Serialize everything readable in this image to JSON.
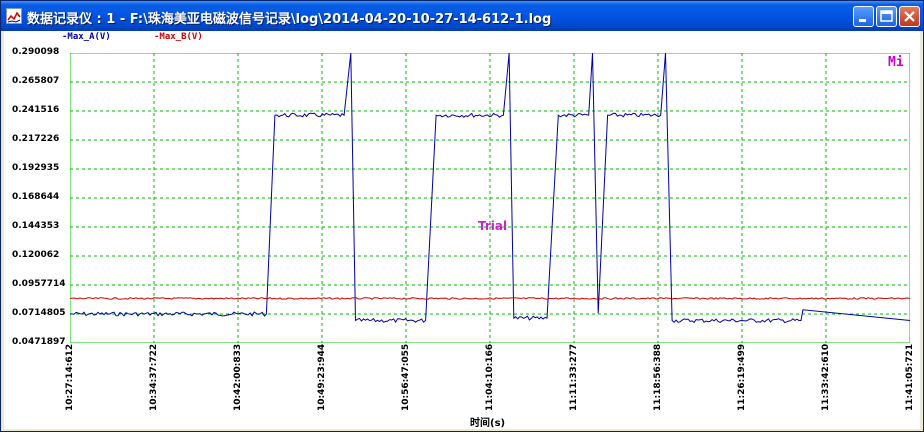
{
  "window": {
    "title": "数据记录仪 : 1 - F:\\珠海美亚电磁波信号记录\\log\\2014-04-20-10-27-14-612-1.log"
  },
  "legend": [
    {
      "label": "-Max_A(V)",
      "color": "#0000aa"
    },
    {
      "label": "-Max_B(V)",
      "color": "#cc0000"
    }
  ],
  "watermark": "Trial",
  "corner_mark": "Mi",
  "chart_data": {
    "type": "line",
    "xlabel": "时间(s)",
    "ylabel": "",
    "ylim": [
      0.0471897,
      0.290098
    ],
    "y_ticks": [
      "0.290098",
      "0.265807",
      "0.241516",
      "0.217226",
      "0.192935",
      "0.168644",
      "0.144353",
      "0.120062",
      "0.0957714",
      "0.0714805",
      "0.0471897"
    ],
    "x_ticks": [
      "10:27:14:612",
      "10:34:37:722",
      "10:42:00:833",
      "10:49:23:944",
      "10:56:47:055",
      "11:04:10:166",
      "11:11:33:277",
      "11:18:56:388",
      "11:26:19:499",
      "11:33:42:610",
      "11:41:05:721"
    ],
    "grid": true,
    "series": [
      {
        "name": "Max_A(V)",
        "color": "#0000aa",
        "x": [
          "10:27:14",
          "10:42:00",
          "10:44:30",
          "10:45:15",
          "10:51:20",
          "10:51:55",
          "10:52:20",
          "10:58:30",
          "10:59:25",
          "11:05:20",
          "11:05:50",
          "11:06:15",
          "11:09:10",
          "11:10:10",
          "11:12:50",
          "11:13:10",
          "11:13:40",
          "11:14:30",
          "11:19:10",
          "11:19:35",
          "11:20:10",
          "11:26:19",
          "11:31:30",
          "11:31:40",
          "11:41:05"
        ],
        "y": [
          0.0715,
          0.0715,
          0.0715,
          0.238,
          0.238,
          0.29,
          0.066,
          0.066,
          0.238,
          0.238,
          0.29,
          0.068,
          0.068,
          0.238,
          0.238,
          0.29,
          0.072,
          0.238,
          0.238,
          0.29,
          0.066,
          0.066,
          0.066,
          0.075,
          0.066
        ]
      },
      {
        "name": "Max_B(V)",
        "color": "#cc0000",
        "x": [
          "10:27:14",
          "11:41:05"
        ],
        "y": [
          0.0845,
          0.0845
        ]
      }
    ]
  }
}
